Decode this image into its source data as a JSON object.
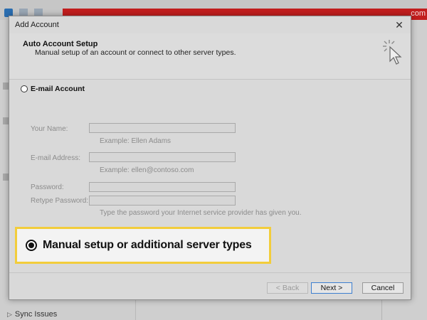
{
  "background": {
    "banner_text": "com",
    "sidebar_item": "Sync Issues"
  },
  "dialog": {
    "title": "Add Account",
    "close_glyph": "✕",
    "header": {
      "title": "Auto Account Setup",
      "subtitle": "Manual setup of an account or connect to other server types."
    },
    "email_option": {
      "label": "E-mail Account",
      "selected": false
    },
    "form": {
      "name_label": "Your Name:",
      "name_value": "",
      "name_hint": "Example: Ellen Adams",
      "email_label": "E-mail Address:",
      "email_value": "",
      "email_hint": "Example: ellen@contoso.com",
      "password_label": "Password:",
      "password_value": "",
      "retype_label": "Retype Password:",
      "retype_value": "",
      "password_hint": "Type the password your Internet service provider has given you."
    },
    "manual_option": {
      "label": "Manual setup or additional server types",
      "selected": true
    },
    "buttons": {
      "back": "< Back",
      "next": "Next >",
      "cancel": "Cancel"
    }
  },
  "colors": {
    "highlight_border": "#f2cd3b",
    "title_red": "#c21e1e",
    "next_border": "#3c7fd0"
  }
}
